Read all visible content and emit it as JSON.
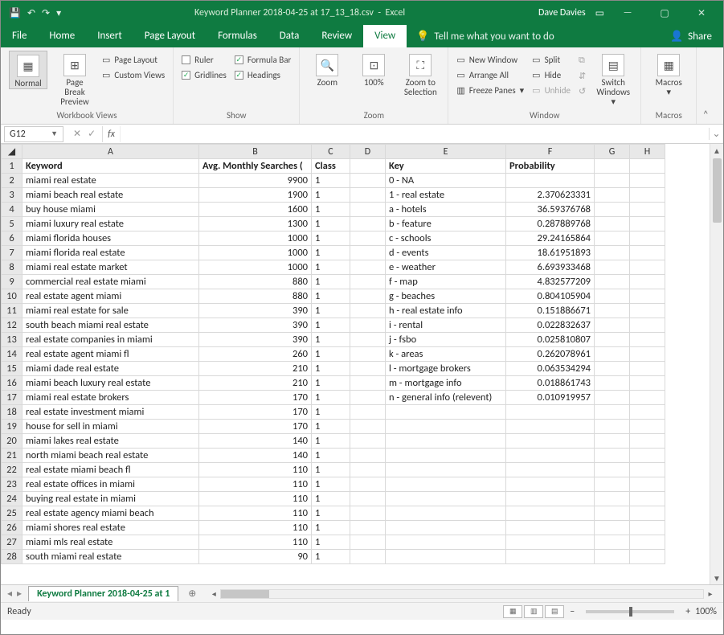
{
  "title": {
    "document": "Keyword Planner 2018-04-25 at 17_13_18.csv",
    "app": "Excel",
    "user": "Dave Davies"
  },
  "qa": {
    "save": "💾",
    "undo": "↶",
    "redo": "↷"
  },
  "win": {
    "min": "—",
    "max": "▢",
    "close": "✕"
  },
  "tabs": {
    "file": "File",
    "home": "Home",
    "insert": "Insert",
    "page_layout": "Page Layout",
    "formulas": "Formulas",
    "data": "Data",
    "review": "Review",
    "view": "View",
    "tellme": "Tell me what you want to do",
    "share": "Share"
  },
  "ribbon": {
    "workbook_views": {
      "normal": "Normal",
      "page_break": "Page Break Preview",
      "page_layout": "Page Layout",
      "custom_views": "Custom Views",
      "group": "Workbook Views"
    },
    "show": {
      "ruler": "Ruler",
      "gridlines": "Gridlines",
      "formula_bar": "Formula Bar",
      "headings": "Headings",
      "group": "Show"
    },
    "zoom": {
      "zoom": "Zoom",
      "hundred": "100%",
      "to_selection": "Zoom to Selection",
      "group": "Zoom"
    },
    "window": {
      "new_window": "New Window",
      "arrange_all": "Arrange All",
      "freeze": "Freeze Panes",
      "split": "Split",
      "hide": "Hide",
      "unhide": "Unhide",
      "switch": "Switch Windows",
      "group": "Window"
    },
    "macros": {
      "macros": "Macros",
      "group": "Macros"
    }
  },
  "namebox": "G12",
  "fx": "",
  "columns": [
    "A",
    "B",
    "C",
    "D",
    "E",
    "F",
    "G",
    "H"
  ],
  "headers": {
    "A": "Keyword",
    "B": "Avg. Monthly Searches (",
    "C": "Class",
    "D": "",
    "E": "Key",
    "F": "Probability",
    "G": "",
    "H": ""
  },
  "rows": [
    {
      "n": 2,
      "A": "miami real estate",
      "B": 9900,
      "C": 1,
      "E": "0 - NA",
      "F": ""
    },
    {
      "n": 3,
      "A": "miami beach real estate",
      "B": 1900,
      "C": 1,
      "E": "1 - real estate",
      "F": "2.370623331"
    },
    {
      "n": 4,
      "A": "buy house miami",
      "B": 1600,
      "C": 1,
      "E": "a - hotels",
      "F": "36.59376768"
    },
    {
      "n": 5,
      "A": "miami luxury real estate",
      "B": 1300,
      "C": 1,
      "E": "b - feature",
      "F": "0.287889768"
    },
    {
      "n": 6,
      "A": "miami florida houses",
      "B": 1000,
      "C": 1,
      "E": "c - schools",
      "F": "29.24165864"
    },
    {
      "n": 7,
      "A": "miami florida real estate",
      "B": 1000,
      "C": 1,
      "E": "d - events",
      "F": "18.61951893"
    },
    {
      "n": 8,
      "A": "miami real estate market",
      "B": 1000,
      "C": 1,
      "E": "e - weather",
      "F": "6.693933468"
    },
    {
      "n": 9,
      "A": "commercial real estate miami",
      "B": 880,
      "C": 1,
      "E": "f - map",
      "F": "4.832577209"
    },
    {
      "n": 10,
      "A": "real estate agent miami",
      "B": 880,
      "C": 1,
      "E": "g - beaches",
      "F": "0.804105904"
    },
    {
      "n": 11,
      "A": "miami real estate for sale",
      "B": 390,
      "C": 1,
      "E": "h - real estate info",
      "F": "0.151886671"
    },
    {
      "n": 12,
      "A": "south beach miami real estate",
      "B": 390,
      "C": 1,
      "E": "i - rental",
      "F": "0.022832637"
    },
    {
      "n": 13,
      "A": "real estate companies in miami",
      "B": 390,
      "C": 1,
      "E": "j - fsbo",
      "F": "0.025810807"
    },
    {
      "n": 14,
      "A": "real estate agent miami fl",
      "B": 260,
      "C": 1,
      "E": "k - areas",
      "F": "0.262078961"
    },
    {
      "n": 15,
      "A": "miami dade real estate",
      "B": 210,
      "C": 1,
      "E": "l - mortgage brokers",
      "F": "0.063534294"
    },
    {
      "n": 16,
      "A": "miami beach luxury real estate",
      "B": 210,
      "C": 1,
      "E": "m - mortgage info",
      "F": "0.018861743"
    },
    {
      "n": 17,
      "A": "miami real estate brokers",
      "B": 170,
      "C": 1,
      "E": "n - general info (relevent)",
      "F": "0.010919957"
    },
    {
      "n": 18,
      "A": "real estate investment miami",
      "B": 170,
      "C": 1,
      "E": "",
      "F": ""
    },
    {
      "n": 19,
      "A": "house for sell in miami",
      "B": 170,
      "C": 1,
      "E": "",
      "F": ""
    },
    {
      "n": 20,
      "A": "miami lakes real estate",
      "B": 140,
      "C": 1,
      "E": "",
      "F": ""
    },
    {
      "n": 21,
      "A": "north miami beach real estate",
      "B": 140,
      "C": 1,
      "E": "",
      "F": ""
    },
    {
      "n": 22,
      "A": "real estate miami beach fl",
      "B": 110,
      "C": 1,
      "E": "",
      "F": ""
    },
    {
      "n": 23,
      "A": "real estate offices in miami",
      "B": 110,
      "C": 1,
      "E": "",
      "F": ""
    },
    {
      "n": 24,
      "A": "buying real estate in miami",
      "B": 110,
      "C": 1,
      "E": "",
      "F": ""
    },
    {
      "n": 25,
      "A": "real estate agency miami beach",
      "B": 110,
      "C": 1,
      "E": "",
      "F": ""
    },
    {
      "n": 26,
      "A": "miami shores real estate",
      "B": 110,
      "C": 1,
      "E": "",
      "F": ""
    },
    {
      "n": 27,
      "A": "miami mls real estate",
      "B": 110,
      "C": 1,
      "E": "",
      "F": ""
    },
    {
      "n": 28,
      "A": "south miami real estate",
      "B": 90,
      "C": 1,
      "E": "",
      "F": ""
    }
  ],
  "sheet_tab": "Keyword Planner 2018-04-25 at 1",
  "status": {
    "ready": "Ready",
    "zoom": "100%"
  }
}
